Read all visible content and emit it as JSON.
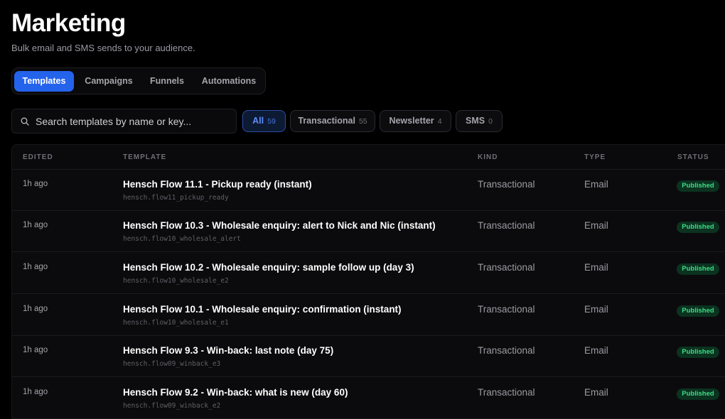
{
  "header": {
    "title": "Marketing",
    "subtitle": "Bulk email and SMS sends to your audience."
  },
  "tabs": [
    {
      "label": "Templates",
      "active": true
    },
    {
      "label": "Campaigns",
      "active": false
    },
    {
      "label": "Funnels",
      "active": false
    },
    {
      "label": "Automations",
      "active": false
    }
  ],
  "search": {
    "placeholder": "Search templates by name or key...",
    "value": "",
    "icon": "search-icon"
  },
  "filters": [
    {
      "label": "All",
      "count": "59",
      "active": true
    },
    {
      "label": "Transactional",
      "count": "55",
      "active": false
    },
    {
      "label": "Newsletter",
      "count": "4",
      "active": false
    },
    {
      "label": "SMS",
      "count": "0",
      "active": false
    }
  ],
  "table": {
    "columns": {
      "edited": "EDITED",
      "template": "TEMPLATE",
      "kind": "KIND",
      "type": "TYPE",
      "status": "STATUS"
    },
    "rows": [
      {
        "edited": "1h ago",
        "name": "Hensch Flow 11.1 - Pickup ready (instant)",
        "key": "hensch.flow11_pickup_ready",
        "kind": "Transactional",
        "type": "Email",
        "status": "Published"
      },
      {
        "edited": "1h ago",
        "name": "Hensch Flow 10.3 - Wholesale enquiry: alert to Nick and Nic (instant)",
        "key": "hensch.flow10_wholesale_alert",
        "kind": "Transactional",
        "type": "Email",
        "status": "Published"
      },
      {
        "edited": "1h ago",
        "name": "Hensch Flow 10.2 - Wholesale enquiry: sample follow up (day 3)",
        "key": "hensch.flow10_wholesale_e2",
        "kind": "Transactional",
        "type": "Email",
        "status": "Published"
      },
      {
        "edited": "1h ago",
        "name": "Hensch Flow 10.1 - Wholesale enquiry: confirmation (instant)",
        "key": "hensch.flow10_wholesale_e1",
        "kind": "Transactional",
        "type": "Email",
        "status": "Published"
      },
      {
        "edited": "1h ago",
        "name": "Hensch Flow 9.3 - Win-back: last note (day 75)",
        "key": "hensch.flow09_winback_e3",
        "kind": "Transactional",
        "type": "Email",
        "status": "Published"
      },
      {
        "edited": "1h ago",
        "name": "Hensch Flow 9.2 - Win-back: what is new (day 60)",
        "key": "hensch.flow09_winback_e2",
        "kind": "Transactional",
        "type": "Email",
        "status": "Published"
      }
    ]
  },
  "colors": {
    "accent": "#2463eb",
    "published_bg": "#0b3320",
    "published_text": "#3ddc84"
  }
}
